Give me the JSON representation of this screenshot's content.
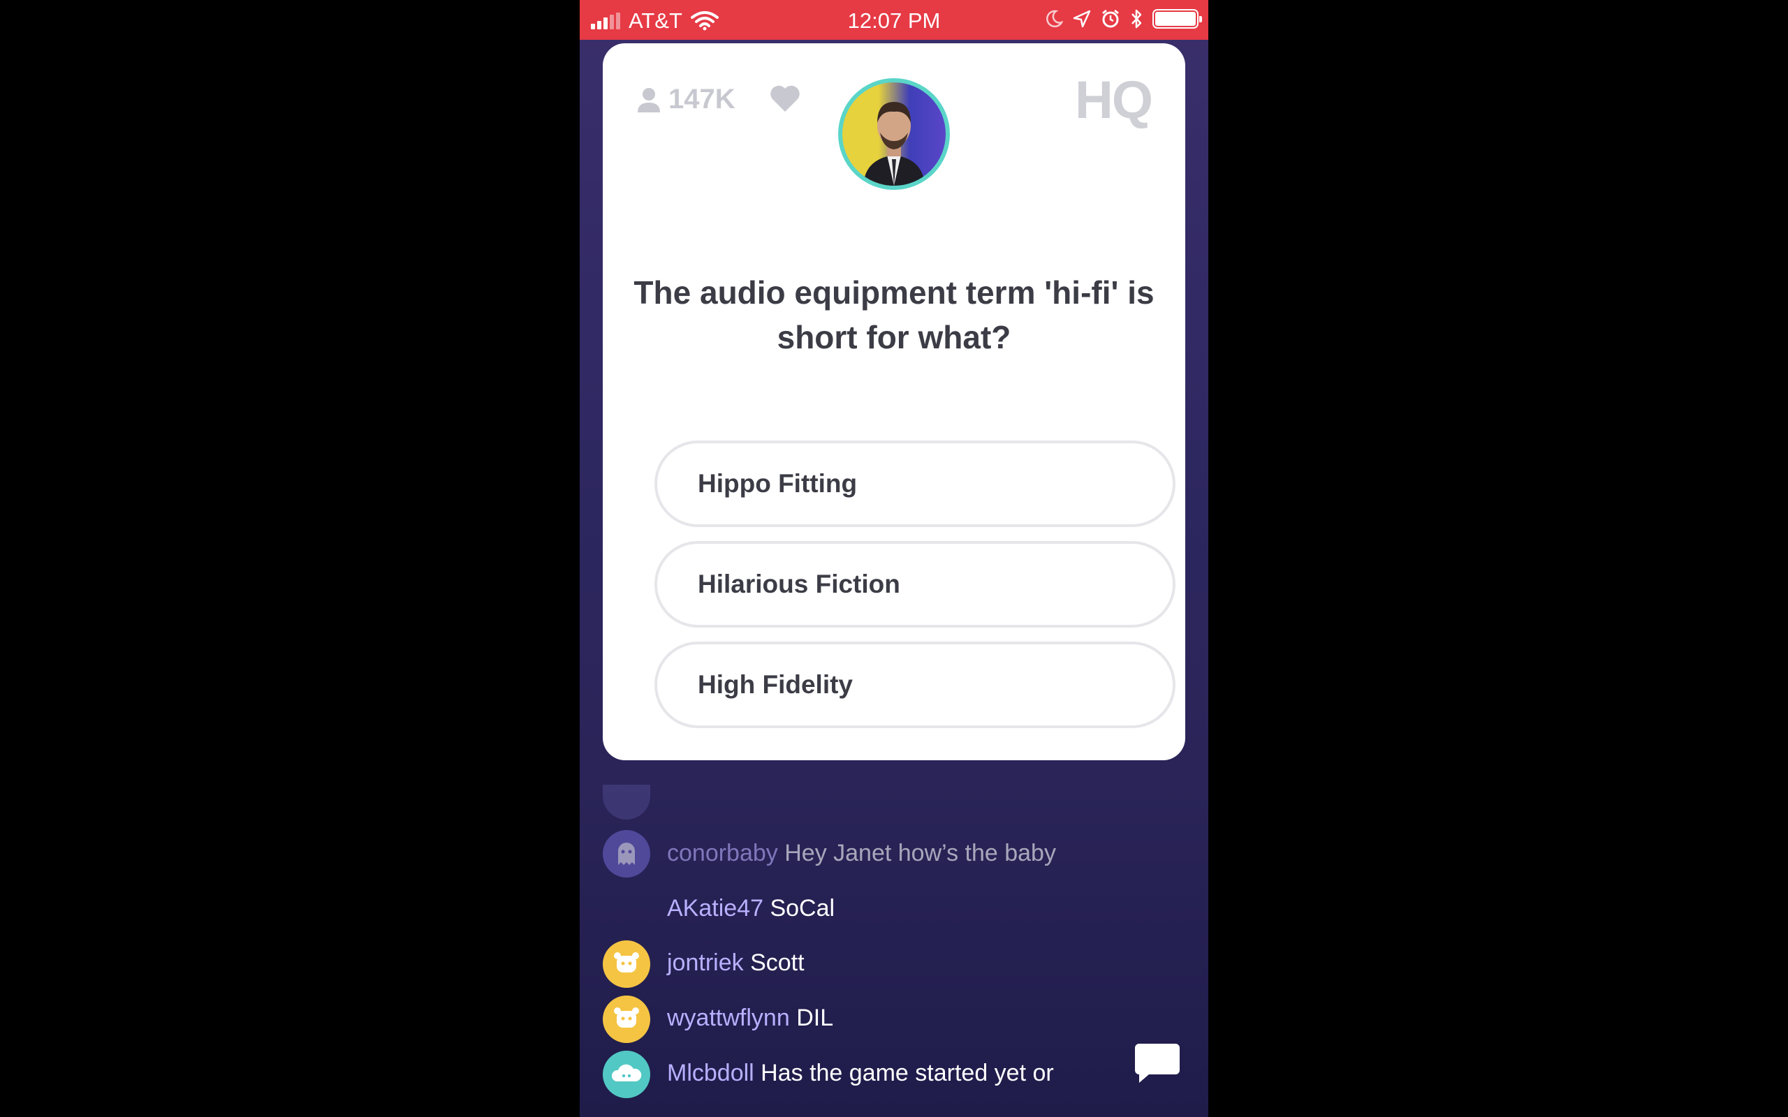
{
  "status_bar": {
    "carrier": "AT&T",
    "time": "12:07 PM"
  },
  "game": {
    "viewer_count": "147K",
    "logo_text": "HQ",
    "question": "The audio equipment term 'hi-fi' is short for what?",
    "answers": [
      "Hippo Fitting",
      "Hilarious Fiction",
      "High Fidelity"
    ]
  },
  "chat": {
    "messages": [
      {
        "user": "conorbaby",
        "text": "Hey Janet how’s the baby",
        "avatar": "ghost-avatar"
      },
      {
        "user": "AKatie47",
        "text": "SoCal",
        "avatar": ""
      },
      {
        "user": "jontriek",
        "text": "Scott",
        "avatar": "yellow-face-avatar"
      },
      {
        "user": "wyattwflynn",
        "text": "DIL",
        "avatar": "yellow-face-avatar"
      },
      {
        "user": "Mlcbdoll",
        "text": "Has the game started yet or",
        "avatar": "cloud-avatar"
      }
    ]
  },
  "colors": {
    "status_bar": "#e63a45",
    "chat_username": "#b9b0ff",
    "timer_ring": "#5ad5c8"
  }
}
